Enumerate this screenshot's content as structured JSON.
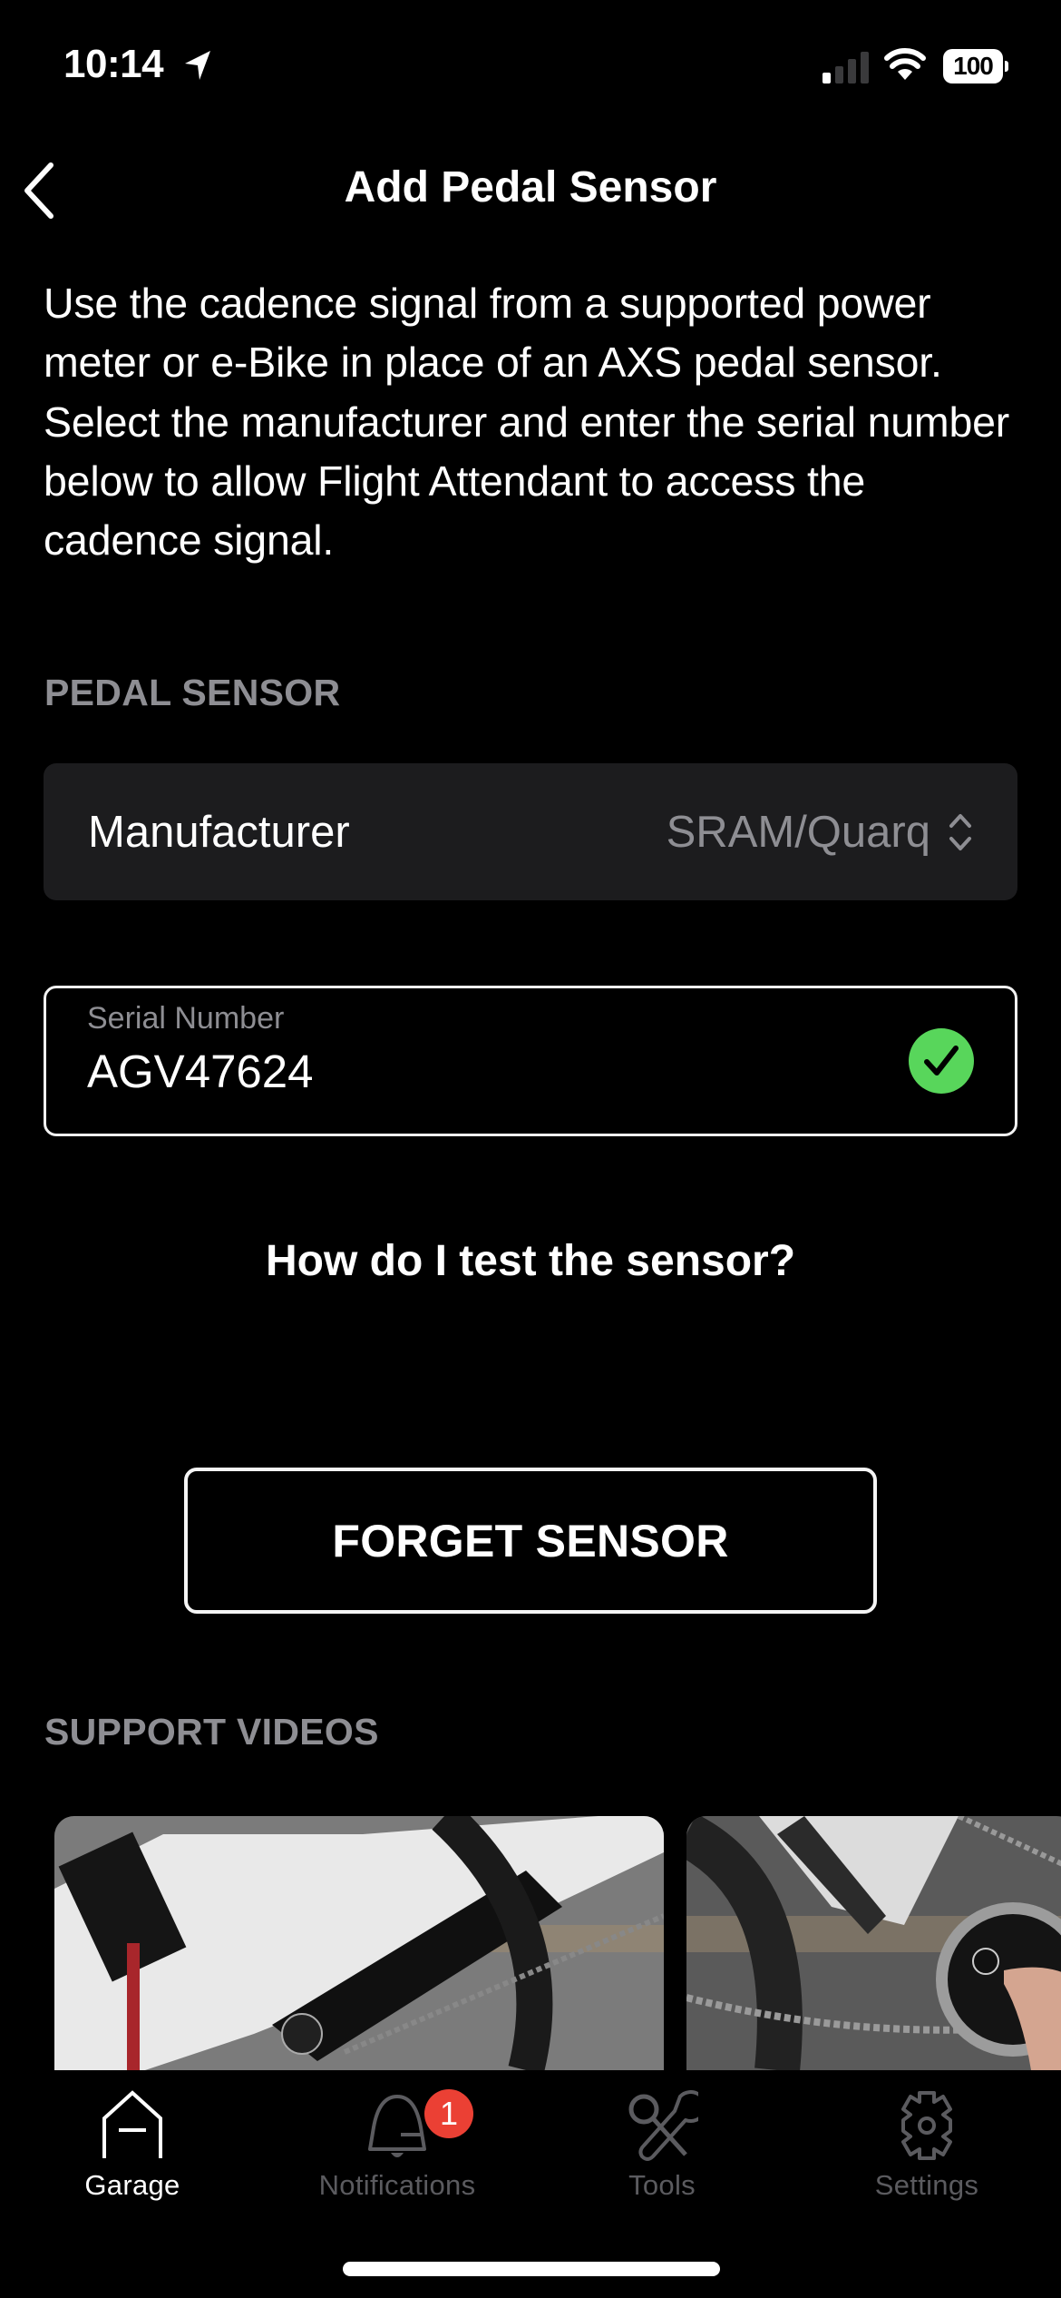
{
  "status_bar": {
    "time": "10:14",
    "battery": "100",
    "signal_bars_active": 1,
    "signal_bars_total": 4
  },
  "nav": {
    "title": "Add Pedal Sensor",
    "back_icon": "chevron-left-icon"
  },
  "description": "Use the cadence signal from a supported power meter or e-Bike in place of an AXS pedal sensor. Select the manufacturer and enter the serial number below to allow Flight Attendant to access the cadence signal.",
  "pedal_sensor": {
    "section_title": "PEDAL SENSOR",
    "manufacturer_label": "Manufacturer",
    "manufacturer_value": "SRAM/Quarq",
    "serial_label": "Serial Number",
    "serial_value": "AGV47624",
    "serial_valid": true
  },
  "help_link": "How do I test the sensor?",
  "forget_button": "FORGET SENSOR",
  "support_videos": {
    "section_title": "SUPPORT VIDEOS",
    "videos": [
      {
        "thumbnail": "bike-crank-thumbnail"
      },
      {
        "thumbnail": "power-meter-spider-thumbnail"
      }
    ]
  },
  "tabs": [
    {
      "label": "Garage",
      "icon": "garage-icon",
      "active": true
    },
    {
      "label": "Notifications",
      "icon": "bell-icon",
      "active": false,
      "badge": "1"
    },
    {
      "label": "Tools",
      "icon": "tools-icon",
      "active": false
    },
    {
      "label": "Settings",
      "icon": "gear-icon",
      "active": false
    }
  ],
  "colors": {
    "background": "#000000",
    "row_background": "#1c1c1e",
    "secondary_text": "#8e8e93",
    "inactive_tab": "#5b5b5f",
    "valid_green": "#58d65b",
    "badge_red": "#eb4034"
  }
}
